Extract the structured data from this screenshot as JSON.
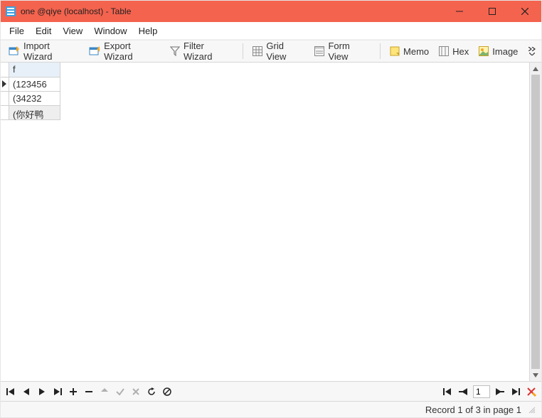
{
  "title": "one @qiye (localhost) - Table",
  "menus": {
    "file": "File",
    "edit": "Edit",
    "view": "View",
    "window": "Window",
    "help": "Help"
  },
  "toolbar": {
    "import": "Import Wizard",
    "export": "Export Wizard",
    "filter": "Filter Wizard",
    "grid": "Grid View",
    "form": "Form View",
    "memo": "Memo",
    "hex": "Hex",
    "image": "Image"
  },
  "grid": {
    "columns": {
      "c1": "f"
    },
    "rows": [
      {
        "c1": "(123456",
        "current": true
      },
      {
        "c1": "(34232",
        "current": false
      },
      {
        "c1": "(你好鸭",
        "current": false,
        "last": true
      }
    ]
  },
  "nav": {
    "page_value": "1"
  },
  "status": {
    "text": "Record 1 of 3 in page 1"
  }
}
